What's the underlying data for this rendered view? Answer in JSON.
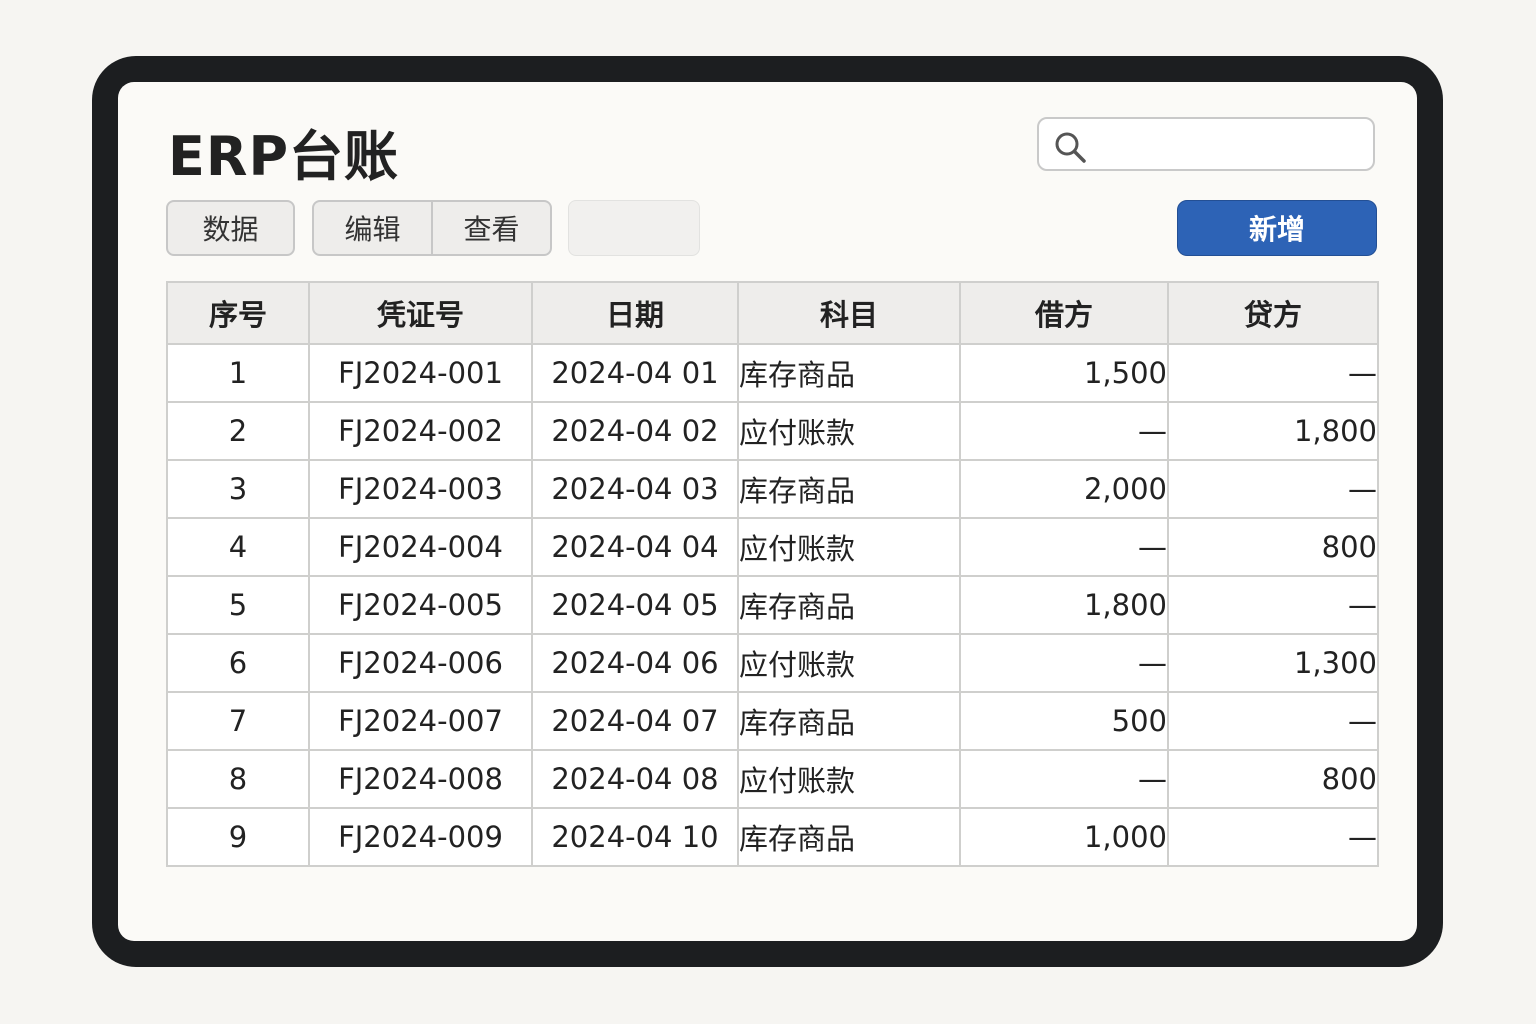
{
  "header": {
    "title": "ERP台账"
  },
  "search": {
    "placeholder": ""
  },
  "toolbar": {
    "data_label": "数据",
    "edit_label": "编辑",
    "view_label": "查看",
    "blank_label": "",
    "new_label": "新增"
  },
  "table": {
    "columns": [
      "序号",
      "凭证号",
      "日期",
      "科目",
      "借方",
      "贷方"
    ],
    "rows": [
      [
        "1",
        "FJ2024-001",
        "2024-04 01",
        "库存商品",
        "1,500",
        "—"
      ],
      [
        "2",
        "FJ2024-002",
        "2024-04 02",
        "应付账款",
        "—",
        "1,800"
      ],
      [
        "3",
        "FJ2024-003",
        "2024-04 03",
        "库存商品",
        "2,000",
        "—"
      ],
      [
        "4",
        "FJ2024-004",
        "2024-04 04",
        "应付账款",
        "—",
        "800"
      ],
      [
        "5",
        "FJ2024-005",
        "2024-04 05",
        "库存商品",
        "1,800",
        "—"
      ],
      [
        "6",
        "FJ2024-006",
        "2024-04 06",
        "应付账款",
        "—",
        "1,300"
      ],
      [
        "7",
        "FJ2024-007",
        "2024-04 07",
        "库存商品",
        "500",
        "—"
      ],
      [
        "8",
        "FJ2024-008",
        "2024-04 08",
        "应付账款",
        "—",
        "800"
      ],
      [
        "9",
        "FJ2024-009",
        "2024-04 10",
        "库存商品",
        "1,000",
        "—"
      ]
    ]
  },
  "colors": {
    "accent": "#2d63b6",
    "frame": "#1c1e20",
    "background": "#f6f5f2"
  },
  "icons": {
    "search": "search-icon"
  }
}
